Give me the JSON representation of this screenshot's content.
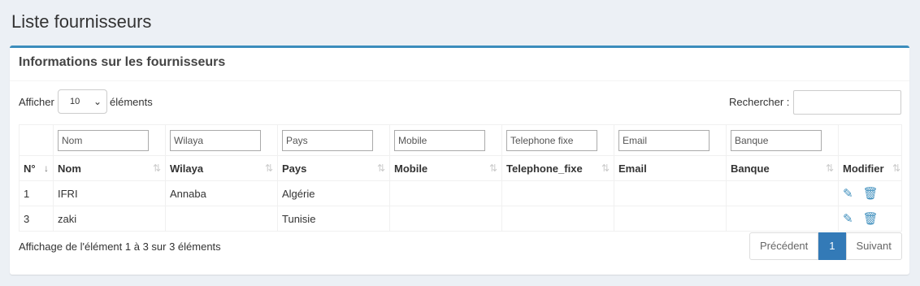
{
  "page_title": "Liste fournisseurs",
  "box_title": "Informations sur les fournisseurs",
  "length": {
    "before": "Afficher",
    "value": "10",
    "after": "éléments"
  },
  "search": {
    "label": "Rechercher :",
    "value": ""
  },
  "filters": [
    "Nom",
    "Wilaya",
    "Pays",
    "Mobile",
    "Telephone fixe",
    "Email",
    "Banque"
  ],
  "headers": [
    "N°",
    "Nom",
    "Wilaya",
    "Pays",
    "Mobile",
    "Telephone_fixe",
    "Email",
    "Banque",
    "Modifier"
  ],
  "rows": [
    {
      "n": "1",
      "nom": "IFRI",
      "wilaya": "Annaba",
      "pays": "Algérie",
      "mobile": "",
      "tel": "",
      "email": "",
      "banque": ""
    },
    {
      "n": "3",
      "nom": "zaki",
      "wilaya": "",
      "pays": "Tunisie",
      "mobile": "",
      "tel": "",
      "email": "",
      "banque": ""
    }
  ],
  "info_text": "Affichage de l'élément 1 à 3 sur 3 éléments",
  "pagination": {
    "prev": "Précédent",
    "current": "1",
    "next": "Suivant"
  },
  "icons": {
    "edit": "edit-icon",
    "delete": "trash-icon",
    "sort": "sort-icon",
    "chevron": "chevron-down-icon"
  },
  "colors": {
    "accent": "#3c8dbc",
    "pager_active": "#337ab7"
  }
}
